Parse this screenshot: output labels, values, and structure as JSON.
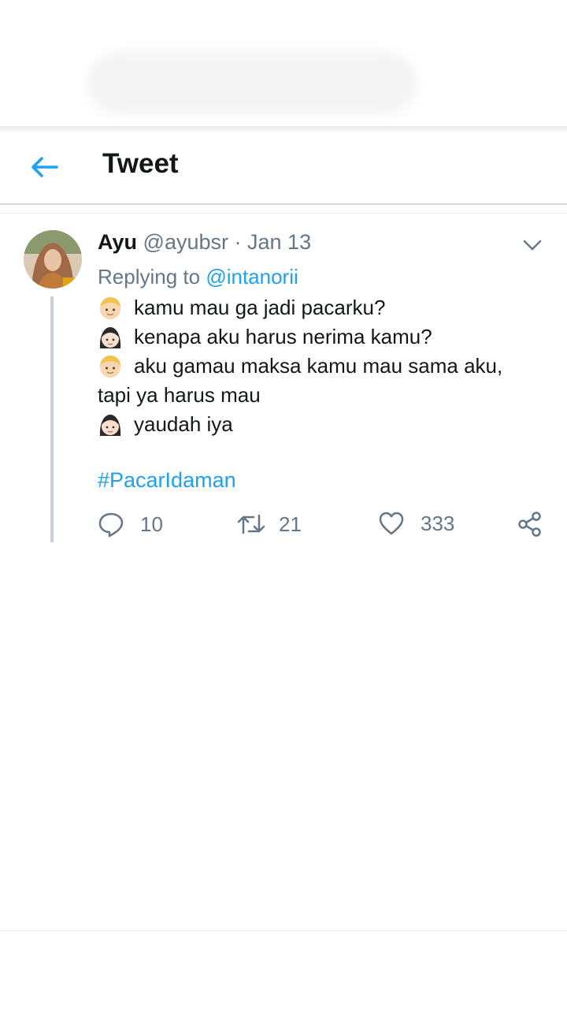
{
  "header": {
    "title": "Tweet",
    "back_icon": "arrow-left-icon"
  },
  "tweet": {
    "author_name": "Ayu",
    "author_handle": "@ayubsr",
    "separator": "·",
    "date": "Jan 13",
    "replying_prefix": "Replying to",
    "replying_handle": "@intanorii",
    "lines": [
      {
        "emoji": "boy-emoji",
        "text": "kamu mau ga jadi pacarku?"
      },
      {
        "emoji": "girl-emoji",
        "text": "kenapa aku harus nerima kamu?"
      },
      {
        "emoji": "boy-emoji",
        "text": "aku gamau maksa kamu mau sama aku,"
      },
      {
        "emoji": "",
        "text": "tapi ya harus mau"
      },
      {
        "emoji": "girl-emoji",
        "text": "yaudah iya"
      }
    ],
    "hashtag": "#PacarIdaman",
    "actions": {
      "reply_count": "10",
      "retweet_count": "21",
      "like_count": "333"
    }
  },
  "colors": {
    "accent": "#1da1f2",
    "secondary_text": "#657786",
    "primary_text": "#14171a"
  }
}
